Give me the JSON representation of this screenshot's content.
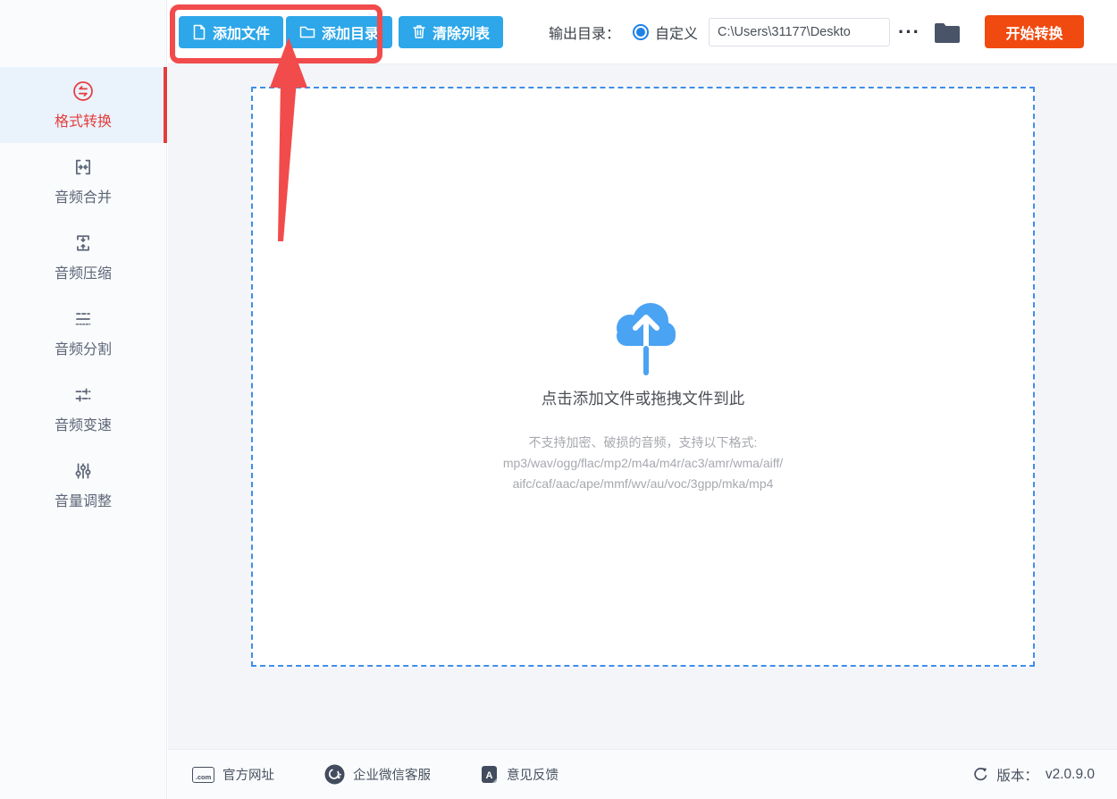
{
  "toolbar": {
    "add_file_label": "添加文件",
    "add_folder_label": "添加目录",
    "clear_list_label": "清除列表",
    "output_dir_label": "输出目录：",
    "custom_label": "自定义",
    "output_path": "C:\\Users\\31177\\Deskto",
    "more_label": "···",
    "start_label": "开始转换"
  },
  "sidebar": {
    "items": [
      {
        "label": "格式转换",
        "icon": "format-convert-icon",
        "selected": true
      },
      {
        "label": "音频合并",
        "icon": "audio-merge-icon",
        "selected": false
      },
      {
        "label": "音频压缩",
        "icon": "audio-compress-icon",
        "selected": false
      },
      {
        "label": "音频分割",
        "icon": "audio-split-icon",
        "selected": false
      },
      {
        "label": "音频变速",
        "icon": "audio-speed-icon",
        "selected": false
      },
      {
        "label": "音量调整",
        "icon": "volume-adjust-icon",
        "selected": false
      }
    ]
  },
  "dropzone": {
    "icon": "cloud-upload-icon",
    "title": "点击添加文件或拖拽文件到此",
    "hint_line1": "不支持加密、破损的音频，支持以下格式:",
    "hint_line2": "mp3/wav/ogg/flac/mp2/m4a/m4r/ac3/amr/wma/aiff/",
    "hint_line3": "aifc/caf/aac/ape/mmf/wv/au/voc/3gpp/mka/mp4"
  },
  "footer": {
    "official_site_label": "官方网址",
    "com_badge": ".com",
    "wechat_service_label": "企业微信客服",
    "feedback_label": "意见反馈",
    "version_label": "版本：",
    "version_value": "v2.0.9.0"
  },
  "colors": {
    "accent_blue": "#2da7e9",
    "radio_blue": "#1f82e5",
    "dropzone_border_blue": "#3f8ee9",
    "cloud_blue": "#4aa3f3",
    "start_orange": "#f04a10",
    "selected_red": "#e43d3d",
    "annotation_red": "#f24b4b",
    "sidebar_gray": "#5d6678"
  }
}
